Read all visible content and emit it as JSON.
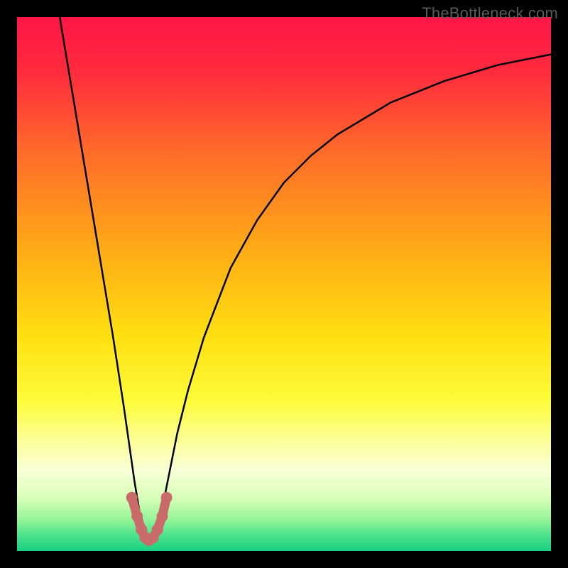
{
  "watermark": "TheBottleneck.com",
  "chart_data": {
    "type": "line",
    "title": "",
    "xlabel": "",
    "ylabel": "",
    "xlim": [
      0,
      100
    ],
    "ylim": [
      0,
      100
    ],
    "series": [
      {
        "name": "bottleneck-curve",
        "x": [
          8,
          10,
          12,
          14,
          16,
          18,
          20,
          21,
          22,
          23,
          24,
          25,
          26,
          27,
          28,
          30,
          32,
          35,
          40,
          45,
          50,
          55,
          60,
          65,
          70,
          75,
          80,
          85,
          90,
          95,
          100
        ],
        "y": [
          100,
          88,
          76,
          64,
          52,
          40,
          27,
          20,
          13,
          7,
          3,
          2,
          3,
          7,
          12,
          22,
          30,
          40,
          53,
          62,
          69,
          74,
          78,
          81,
          84,
          86,
          88,
          89.5,
          91,
          92,
          93
        ]
      }
    ],
    "markers": {
      "name": "minimum-markers",
      "color": "#c96b6b",
      "x": [
        21.5,
        22.5,
        23.3,
        24.0,
        24.7,
        25.5,
        26.3,
        27.2,
        28.0
      ],
      "y": [
        10,
        6.5,
        4,
        2.5,
        2,
        2.5,
        4,
        6.5,
        10
      ]
    },
    "gradient_stops": [
      {
        "offset": 0.0,
        "color": "#ff1646"
      },
      {
        "offset": 0.1,
        "color": "#ff2a3e"
      },
      {
        "offset": 0.25,
        "color": "#ff6a2a"
      },
      {
        "offset": 0.45,
        "color": "#ffb015"
      },
      {
        "offset": 0.6,
        "color": "#ffe012"
      },
      {
        "offset": 0.72,
        "color": "#fdfc3a"
      },
      {
        "offset": 0.8,
        "color": "#fbffa0"
      },
      {
        "offset": 0.85,
        "color": "#f8ffd6"
      },
      {
        "offset": 0.9,
        "color": "#d8ffb8"
      },
      {
        "offset": 0.94,
        "color": "#98f598"
      },
      {
        "offset": 0.97,
        "color": "#4de28c"
      },
      {
        "offset": 1.0,
        "color": "#17d080"
      }
    ]
  }
}
